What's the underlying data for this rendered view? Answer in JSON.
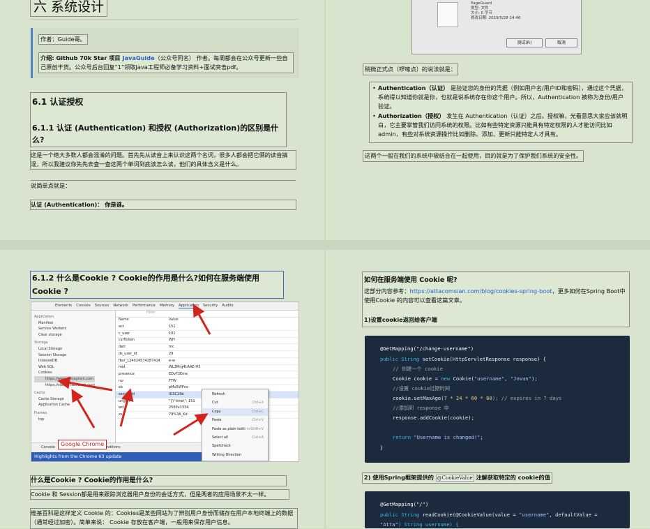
{
  "page": {
    "tl": {
      "section_title": "六 系统设计",
      "author": "作者：Guide哥。",
      "intro_a": "介绍: Github 70k Star 项目 ",
      "intro_link": "JavaGuide",
      "intro_b": "（公众号同名） 作者。每周都会在公众号更新一些自己原创干货。公众号后台回复“1”领取Java工程师必备学习资料+面试突击pdf。",
      "h2": "6.1 认证授权",
      "h3": "6.1.1 认证 (Authentication) 和授权 (Authorization)的区别是什么?",
      "p1": "这是一个绝大多数人都会混淆的问题。首先先从读音上来认识这两个名词，很多人都会把它俩的读音搞混，所以我建议你先先去查一查这两个单词到底该怎么读，他们的具体含义是什么。",
      "p2": "说简单点就是：",
      "p3": "认证 (Authentication)： 你是谁。"
    },
    "tr": {
      "dlg_name": "PageGuard",
      "dlg_type": "类型: 文件",
      "dlg_size": "大小: 0 字节",
      "dlg_date": "修改日期: 2019/5/28 14:46",
      "btn_test": "测试(R)",
      "btn_cancel": "取消",
      "lead": "稍微正式点（啰嗦点）的说法就是：",
      "b1_strong": "Authentication（认证）",
      "b1": " 是验证您的身份的凭据（例如用户名/用户ID和密码），通过这个凭据，系统得以知道你就是你，也就是说系统存在你这个用户。所以，Authentication 被称为身份/用户验证。",
      "b2_strong": "Authorization（授权）",
      "b2": " 发生在 Authentication（认证）之后。授权嘛，光看意思大家应该就明白，它主要掌管我们访问系统的权限。比如有些特定资源只能具有特定权限的人才能访问比如admin，有些对系统资源操作比如删除、添加、更新只能特定人才具有。",
      "p_end": "这两个一般在我们的系统中被结合在一起使用，目的就是为了保护我们系统的安全性。"
    },
    "bl": {
      "h3": "6.1.2 什么是Cookie ? Cookie的作用是什么?如何在服务端使用 Cookie ?",
      "devtools_tabs": [
        "Elements",
        "Console",
        "Sources",
        "Network",
        "Performance",
        "Memory",
        "Application",
        "Security",
        "Audits"
      ],
      "sidebar": [
        "Application",
        "Manifest",
        "Service Workers",
        "Clear storage",
        "Storage",
        "Local Storage",
        "Session Storage",
        "IndexedDB",
        "Web SQL",
        "Cookies",
        "https://www.instagram.com",
        "https://statics.facebook.com",
        "Cache",
        "Cache Storage",
        "Application Cache",
        "Frames",
        "top"
      ],
      "col_name": "Name",
      "col_value": "Value",
      "rows": [
        [
          "act",
          "151"
        ],
        [
          "c_user",
          "101"
        ],
        [
          "csrftoken",
          "WH"
        ],
        [
          "datr",
          "mc"
        ],
        [
          "ds_user_id",
          "29"
        ],
        [
          "fbsr_124024574287414",
          "e-w"
        ],
        [
          "mid",
          "WL3Mrg4LAAE-H3"
        ],
        [
          "presence",
          "EDvF3Eme"
        ],
        [
          "rur",
          "FTW"
        ],
        [
          "sb",
          "pMu5WPxx"
        ],
        [
          "sessionid",
          "IGSC29b"
        ],
        [
          "urlgen",
          "\"{\\\"time\\\": 151"
        ],
        [
          "wd",
          "2560x1334"
        ],
        [
          "xs",
          "79%3A_Kd"
        ]
      ],
      "menu": [
        [
          "Refresh",
          ""
        ],
        [
          "Cut",
          "Ctrl+X"
        ],
        [
          "Copy",
          "Ctrl+C"
        ],
        [
          "Paste",
          "Ctrl+V"
        ],
        [
          "Paste as plain text",
          "Ctrl+Shift+V"
        ],
        [
          "Select all",
          "Ctrl+A"
        ],
        [
          "Spellcheck",
          ""
        ],
        [
          "Writing Direction",
          ""
        ]
      ],
      "chrome_label": "Google Chrome",
      "console_bar": "Console",
      "conditions": "conditions",
      "highlights": "Highlights from the Chrome 63 update",
      "filter": "Filter",
      "h4": "什么是Cookie ? Cookie的作用是什么?",
      "p1": "Cookie 和 Session都是用来跟踪浏览器用户身份的会话方式，但是两者的应用场景不太一样。",
      "p2": "维基百科是这样定义 Cookie 的：Cookies是某些网站为了辨别用户身份而储存在用户本地终端上的数据（通常经过加密）。简单来说： Cookie 存放在客户端，一般用来保存用户信息。"
    },
    "br": {
      "h4": "如何在服务端使用 Cookie 呢?",
      "ref_a": "这部分内容参考：",
      "ref_link": "https://attacomsian.com/blog/cookies-spring-boot",
      "ref_b": "，更多如何在Spring Boot中使用Cookie 的内容可以查看这篇文章。",
      "step1": "1)设置cookie返回给客户端",
      "code1": {
        "l1": "@GetMapping(\"/change-username\")",
        "l2a": "public String ",
        "l2b": "setCookie(HttpServletResponse response) {",
        "l3": "// 创建一个 cookie",
        "l4a": "Cookie cookie = ",
        "l4b": "new ",
        "l4c": "Cookie(",
        "l4d": "\"username\"",
        "l4e": ", ",
        "l4f": "\"Jovan\"",
        "l4g": ");",
        "l5": "//设置 cookie过期时间",
        "l6a": "cookie.setMaxAge(",
        "l6b": "7 * 24 * 60 * 60",
        "l6c": "); // expires in 7 days",
        "l7": "//添加到 response 中",
        "l8": "response.addCookie(cookie);",
        "l9a": "return ",
        "l9b": "\"Username is changed!\"",
        "l9c": ";",
        "l10": "}"
      },
      "step2a": "2) 使用Spring框架提供的 ",
      "step2code": "@CookieValue",
      "step2b": " 注解获取特定的 cookie的值",
      "code2": {
        "l1": "@GetMapping(\"/\")",
        "l2a": "public String ",
        "l2b": "readCookie(@CookieValue(value = ",
        "l2c": "\"username\"",
        "l2d": ", defaultValue = ",
        "l3a": "\"Atta\"",
        "l3b": ") String username) {"
      }
    }
  },
  "colors": {
    "background": "#cfdcc4",
    "link": "#2a62c9",
    "code_bg": "#1b2a3d",
    "arrow": "#d2231c",
    "chrome_label": "#c61f1f"
  }
}
